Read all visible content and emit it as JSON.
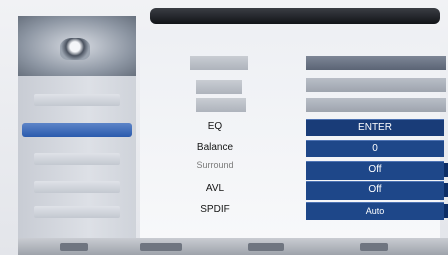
{
  "settings": {
    "rows": [
      {
        "label": "EQ",
        "value": "ENTER",
        "dimmed": false
      },
      {
        "label": "Balance",
        "value": "0",
        "dimmed": false
      },
      {
        "label": "Surround",
        "value": "Off",
        "dimmed": true
      },
      {
        "label": "AVL",
        "value": "Off",
        "dimmed": false
      },
      {
        "label": "SPDIF",
        "value": "Auto",
        "dimmed": false
      }
    ]
  },
  "colors": {
    "value_background": "#1e4789",
    "active_sidebar": "#2a5aad"
  },
  "icons": {
    "home": "home-icon"
  }
}
